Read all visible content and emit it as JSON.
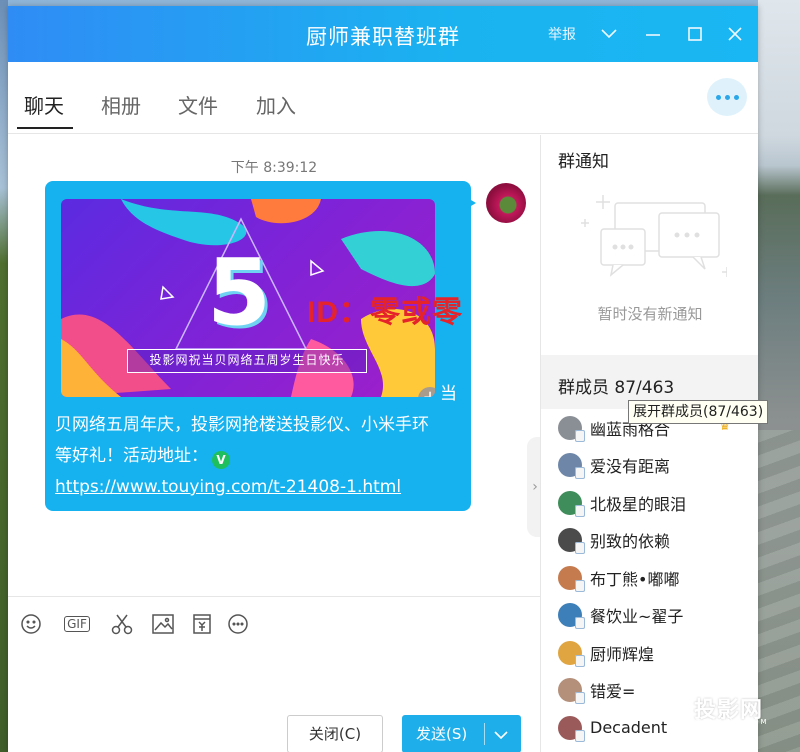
{
  "window": {
    "title": "厨师兼职替班群",
    "report_label": "举报"
  },
  "tabs": [
    {
      "label": "聊天",
      "active": true
    },
    {
      "label": "相册"
    },
    {
      "label": "文件"
    },
    {
      "label": "加入"
    }
  ],
  "chat": {
    "timestamp": "下午 8:39:12",
    "banner_caption": "投影网祝当贝网络五周岁生日快乐",
    "banner_number": "5",
    "overlay_watermark": "ID：零或零",
    "message": {
      "line1_tail": "当",
      "line2": "贝网络五周年庆，投影网抢楼送投影仪、小米手环",
      "line3": "等好礼！活动地址：",
      "badge": "V",
      "link": "https://www.touying.com/t-21408-1.html"
    }
  },
  "composer": {
    "gif_label": "GIF",
    "close_label": "关闭(C)",
    "send_label": "发送(S)"
  },
  "sidebar": {
    "notice_title": "群通知",
    "notice_empty": "暂时没有新通知",
    "members_title": "群成员 87/463",
    "tooltip": "展开群成员(87/463)",
    "members": [
      {
        "name": "幽蓝雨格合",
        "avatar_color": "#8a8f96"
      },
      {
        "name": "爱没有距离",
        "avatar_color": "#6e87a8"
      },
      {
        "name": "北极星的眼泪",
        "avatar_color": "#3f8d5a"
      },
      {
        "name": "别致的依赖",
        "avatar_color": "#4b4b4b"
      },
      {
        "name": "布丁熊•嘟嘟",
        "avatar_color": "#c57b4e"
      },
      {
        "name": "餐饮业~翟子",
        "avatar_color": "#3d7fb8"
      },
      {
        "name": "厨师辉煌",
        "avatar_color": "#e0a540"
      },
      {
        "name": "错爱=",
        "avatar_color": "#b48f7a"
      },
      {
        "name": "Decadent",
        "avatar_color": "#9b5a5a"
      }
    ]
  },
  "logo_watermark": {
    "text": "投影网",
    "sub": "TOUYING.COM"
  },
  "colors": {
    "titlebar_start": "#2f8cf5",
    "titlebar_end": "#19b7f3",
    "bubble": "#16b2f0",
    "send_button": "#1eaee9"
  }
}
